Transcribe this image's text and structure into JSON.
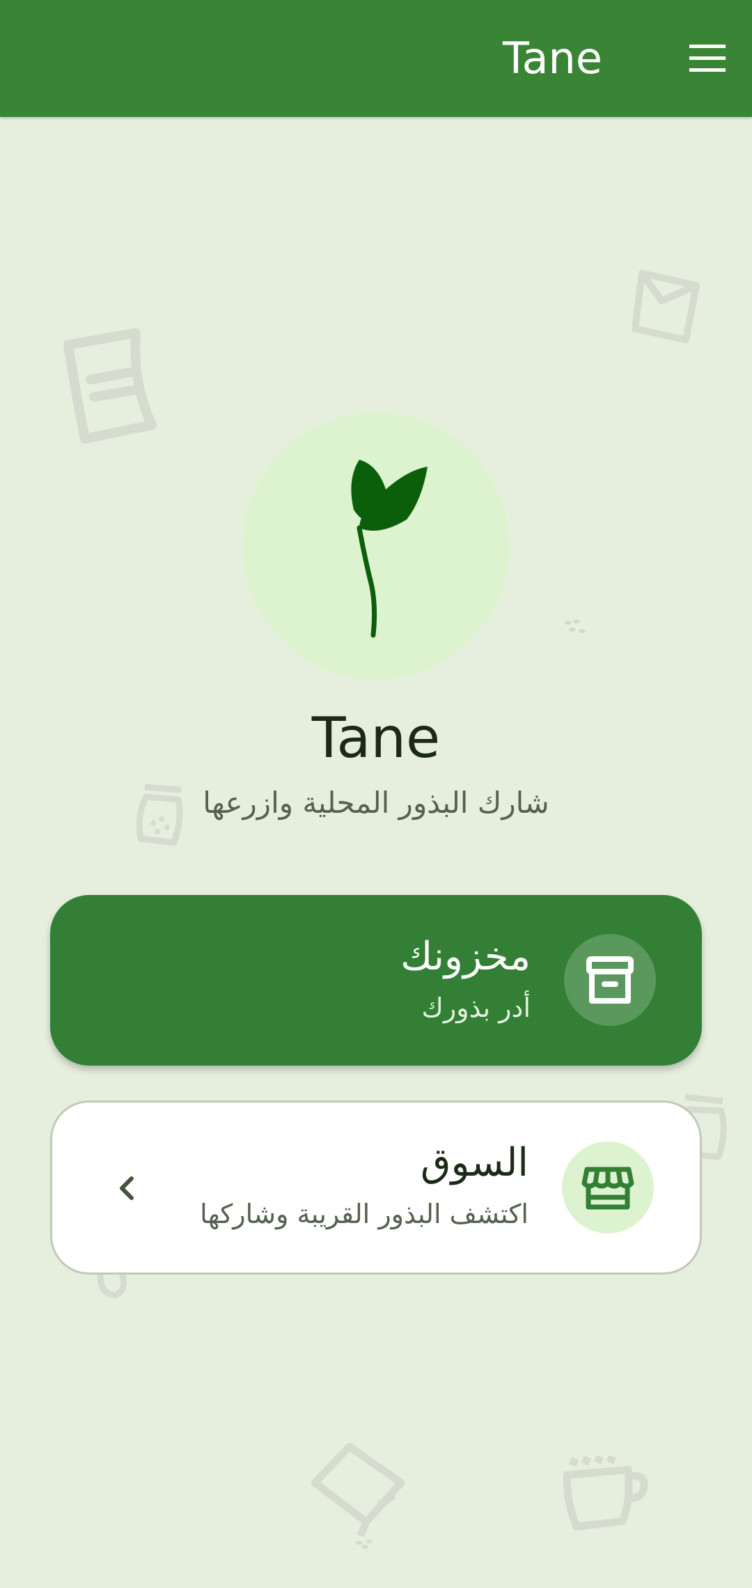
{
  "app_bar": {
    "title": "Tane",
    "menu_icon": "menu-icon"
  },
  "colors": {
    "app_bar": "#3a8435",
    "background": "#e6efde",
    "primary_card": "#327f35",
    "sprout": "#0b5e0a",
    "icon_circle": "#ddf3cf"
  },
  "hero": {
    "icon": "sprout-icon",
    "title": "Tane",
    "subtitle": "شارك البذور المحلية وازرعها"
  },
  "cards": {
    "inventory": {
      "title": "مخزونك",
      "subtitle": "أدر بذورك",
      "icon": "archive-icon"
    },
    "market": {
      "title": "السوق",
      "subtitle": "اكتشف البذور القريبة وشاركها",
      "icon": "storefront-icon",
      "chevron_icon": "chevron-left-icon"
    }
  }
}
